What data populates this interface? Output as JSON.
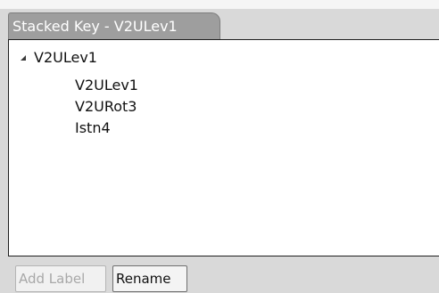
{
  "tab": {
    "title": "Stacked Key - V2ULev1"
  },
  "tree": {
    "root": {
      "label": "V2ULev1",
      "expanded": true,
      "children": [
        {
          "label": "V2ULev1"
        },
        {
          "label": "V2URot3"
        },
        {
          "label": "Istn4"
        }
      ]
    }
  },
  "buttons": {
    "add_label": "Add Label",
    "add_label_enabled": false,
    "rename": "Rename"
  }
}
